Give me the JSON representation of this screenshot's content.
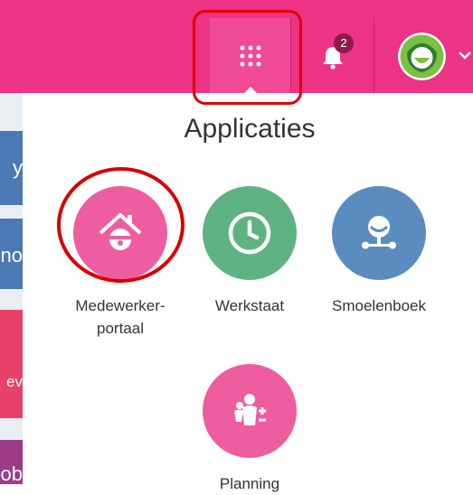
{
  "header": {
    "apps_icon": "grid-dots-icon",
    "notification_count": "2",
    "bell_icon": "bell-icon",
    "avatar_icon": "avatar-icon",
    "chevron_icon": "chevron-down-icon",
    "accent_color": "#ec3384"
  },
  "sidebar": {
    "fragments": [
      "y",
      "no",
      "ev",
      "ob"
    ]
  },
  "panel": {
    "title": "Applicaties",
    "apps": [
      {
        "label": "Medewerker-\nportaal",
        "icon": "home-person-icon",
        "color": "#ef5da1"
      },
      {
        "label": "Werkstaat",
        "icon": "clock-icon",
        "color": "#5fb383"
      },
      {
        "label": "Smoelenboek",
        "icon": "person-network-icon",
        "color": "#5b8cc0"
      },
      {
        "label": "Planning",
        "icon": "planning-people-icon",
        "color": "#ef5da1"
      }
    ]
  }
}
